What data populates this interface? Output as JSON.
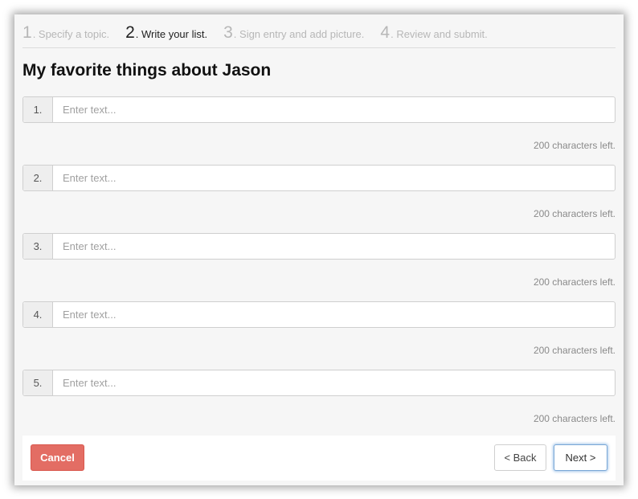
{
  "steps": [
    {
      "num": "1",
      "label": ". Specify a topic."
    },
    {
      "num": "2",
      "label": ". Write your list."
    },
    {
      "num": "3",
      "label": ". Sign entry and add picture."
    },
    {
      "num": "4",
      "label": ". Review and submit."
    }
  ],
  "active_step": 2,
  "title": "My favorite things about Jason",
  "items": [
    {
      "num": "1.",
      "value": "",
      "placeholder": "Enter text...",
      "chars_left": "200 characters left."
    },
    {
      "num": "2.",
      "value": "",
      "placeholder": "Enter text...",
      "chars_left": "200 characters left."
    },
    {
      "num": "3.",
      "value": "",
      "placeholder": "Enter text...",
      "chars_left": "200 characters left."
    },
    {
      "num": "4.",
      "value": "",
      "placeholder": "Enter text...",
      "chars_left": "200 characters left."
    },
    {
      "num": "5.",
      "value": "",
      "placeholder": "Enter text...",
      "chars_left": "200 characters left."
    }
  ],
  "buttons": {
    "cancel": "Cancel",
    "back": "< Back",
    "next": "Next >"
  },
  "colors": {
    "cancel": "#e36d64",
    "next_focus": "#7aa7d6"
  }
}
